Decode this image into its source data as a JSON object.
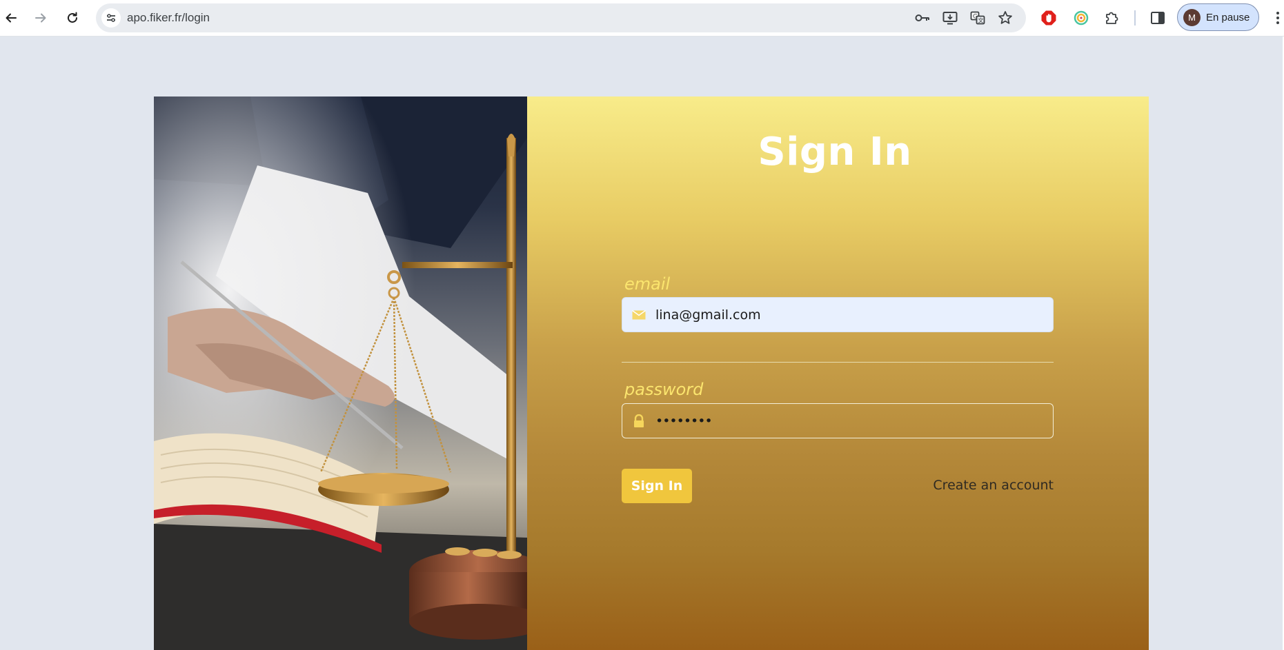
{
  "browser": {
    "url": "apo.fiker.fr/login",
    "profile_initial": "M",
    "profile_status": "En pause",
    "icons": [
      "back-icon",
      "forward-icon",
      "reload-icon",
      "site-info-icon",
      "password-key-icon",
      "install-app-icon",
      "translate-icon",
      "bookmark-star-icon",
      "adblock-extension-icon",
      "extension-icon",
      "extensions-puzzle-icon",
      "side-panel-icon",
      "more-menu-icon"
    ]
  },
  "colors": {
    "page_background": "#e1e6ee",
    "panel_gradient_top": "#f8ec8a",
    "panel_gradient_bottom": "#9a6018",
    "label_color": "#fbe56e",
    "button_color": "#f0c63d"
  },
  "login": {
    "title": "Sign In",
    "email_label": "email",
    "email_value": "lina@gmail.com",
    "password_label": "password",
    "password_value": "••••••••",
    "submit_label": "Sign In",
    "create_account_label": "Create an account"
  }
}
